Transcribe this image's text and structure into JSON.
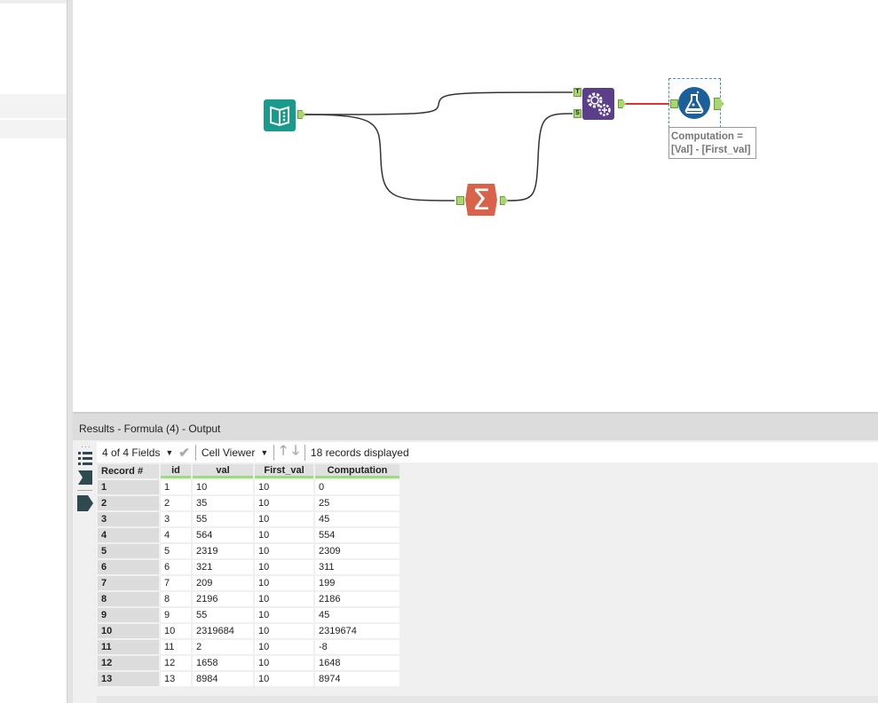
{
  "results": {
    "title": "Results - Formula (4) - Output"
  },
  "toolbar": {
    "fields": "4 of 4 Fields",
    "viewer": "Cell Viewer",
    "records": "18 records displayed"
  },
  "annotation": {
    "line1": "Computation =",
    "line2": "[Val] - [First_val]"
  },
  "anchors": {
    "join_t": "T",
    "join_s": "S"
  },
  "colors": {
    "input": "#1a9a8a",
    "join": "#5b3f8a",
    "summarize": "#d9634a",
    "formula": "#1d5f9b",
    "connection_selected": "#e53030",
    "anchor": "#a9d66e"
  },
  "table": {
    "headers": [
      "Record #",
      "id",
      "val",
      "First_val",
      "Computation"
    ],
    "rows": [
      [
        "1",
        "1",
        "10",
        "10",
        "0"
      ],
      [
        "2",
        "2",
        "35",
        "10",
        "25"
      ],
      [
        "3",
        "3",
        "55",
        "10",
        "45"
      ],
      [
        "4",
        "4",
        "564",
        "10",
        "554"
      ],
      [
        "5",
        "5",
        "2319",
        "10",
        "2309"
      ],
      [
        "6",
        "6",
        "321",
        "10",
        "311"
      ],
      [
        "7",
        "7",
        "209",
        "10",
        "199"
      ],
      [
        "8",
        "8",
        "2196",
        "10",
        "2186"
      ],
      [
        "9",
        "9",
        "55",
        "10",
        "45"
      ],
      [
        "10",
        "10",
        "2319684",
        "10",
        "2319674"
      ],
      [
        "11",
        "11",
        "2",
        "10",
        "-8"
      ],
      [
        "12",
        "12",
        "1658",
        "10",
        "1648"
      ],
      [
        "13",
        "13",
        "8984",
        "10",
        "8974"
      ]
    ]
  }
}
